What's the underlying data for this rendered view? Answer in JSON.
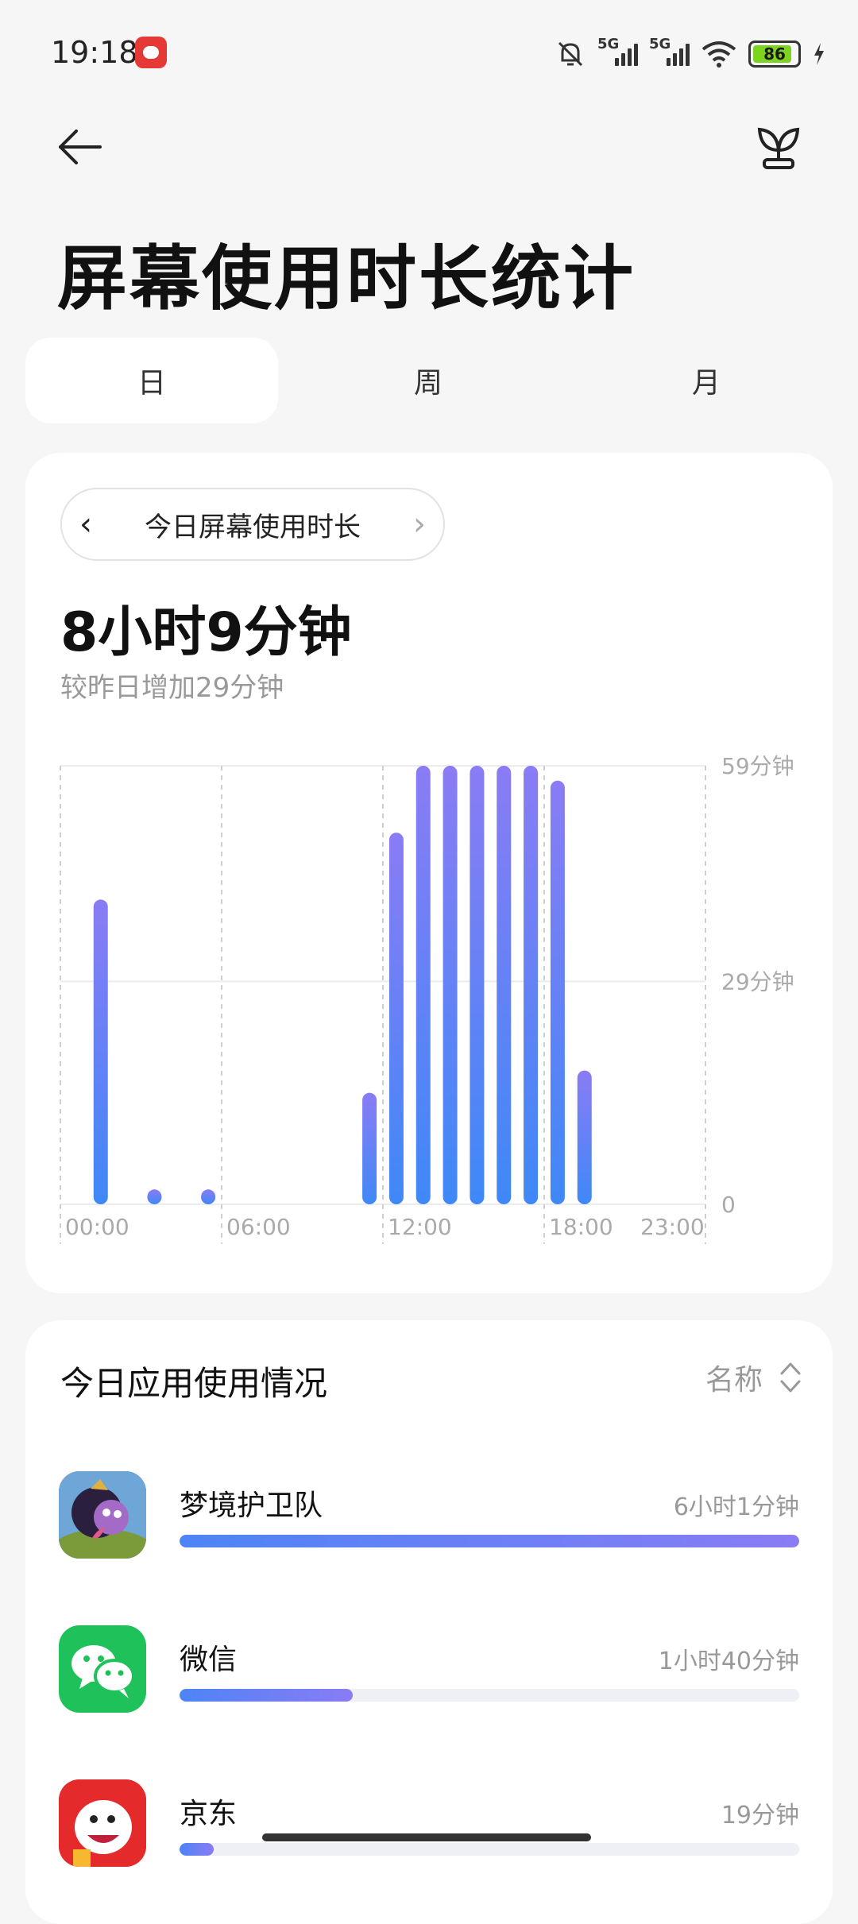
{
  "status_bar": {
    "time": "19:18",
    "network_label_1": "5G",
    "network_label_2": "5G",
    "battery_level": "86",
    "icons": [
      "notification-app-icon",
      "mute-icon",
      "signal-icon",
      "wifi-icon",
      "battery-icon",
      "charging-icon"
    ]
  },
  "header": {
    "back_icon": "arrow-left-icon",
    "action_icon": "sprout-icon",
    "title": "屏幕使用时长统计"
  },
  "tabs": [
    {
      "label": "日",
      "active": true
    },
    {
      "label": "周",
      "active": false
    },
    {
      "label": "月",
      "active": false
    }
  ],
  "summary": {
    "period_label": "今日屏幕使用时长",
    "total": "8小时9分钟",
    "comparison": "较昨日增加29分钟"
  },
  "chart_data": {
    "type": "bar",
    "unit": "minutes",
    "y_ticks": [
      "59分钟",
      "29分钟",
      "0"
    ],
    "ylim": [
      0,
      59
    ],
    "x_tick_labels": [
      "00:00",
      "06:00",
      "12:00",
      "18:00",
      "23:00"
    ],
    "categories": [
      "0",
      "1",
      "2",
      "3",
      "4",
      "5",
      "6",
      "7",
      "8",
      "9",
      "10",
      "11",
      "12",
      "13",
      "14",
      "15",
      "16",
      "17",
      "18",
      "19",
      "20",
      "21",
      "22",
      "23"
    ],
    "values": [
      0,
      41,
      0,
      2,
      0,
      2,
      0,
      0,
      0,
      0,
      0,
      15,
      50,
      59,
      59,
      59,
      59,
      59,
      57,
      18,
      0,
      0,
      0,
      0
    ],
    "bar_color_top": "#8a7cf4",
    "bar_color_bottom": "#3f88f7",
    "grid": true
  },
  "usage": {
    "title": "今日应用使用情况",
    "sort_label": "名称",
    "apps": [
      {
        "name": "梦境护卫队",
        "time": "6小时1分钟",
        "progress": 1.0,
        "icon": "dream-guard-app-icon"
      },
      {
        "name": "微信",
        "time": "1小时40分钟",
        "progress": 0.28,
        "icon": "wechat-app-icon"
      },
      {
        "name": "京东",
        "time": "19分钟",
        "progress": 0.055,
        "icon": "jd-app-icon"
      }
    ]
  }
}
